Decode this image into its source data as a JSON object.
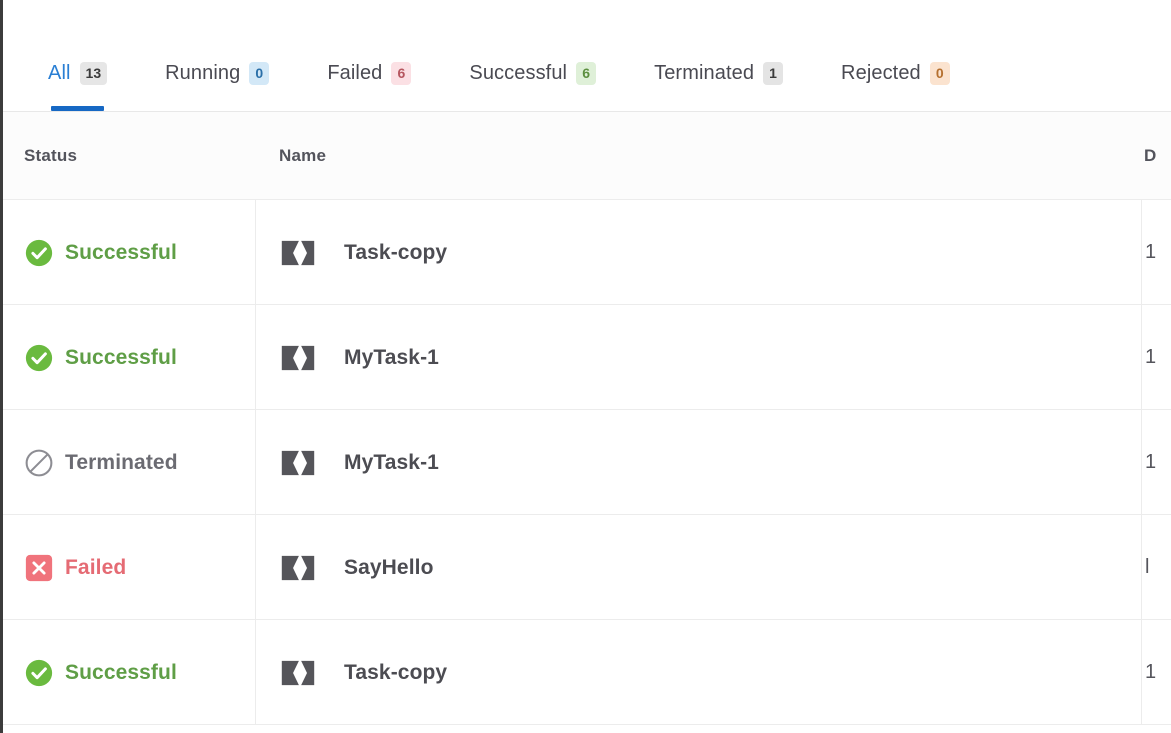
{
  "tabs": [
    {
      "label": "All",
      "count": "13",
      "active": true,
      "badge_bg": "#e6e6e6",
      "badge_fg": "#3a3a3a",
      "icon": "tab-all"
    },
    {
      "label": "Running",
      "count": "0",
      "active": false,
      "badge_bg": "#d3e8f7",
      "badge_fg": "#2a6fa8",
      "icon": "tab-running"
    },
    {
      "label": "Failed",
      "count": "6",
      "active": false,
      "badge_bg": "#fbe0e4",
      "badge_fg": "#b5565f",
      "icon": "tab-failed"
    },
    {
      "label": "Successful",
      "count": "6",
      "active": false,
      "badge_bg": "#dff0d8",
      "badge_fg": "#5c8f3f",
      "icon": "tab-successful"
    },
    {
      "label": "Terminated",
      "count": "1",
      "active": false,
      "badge_bg": "#e4e4e4",
      "badge_fg": "#3a3a3a",
      "icon": "tab-terminated"
    },
    {
      "label": "Rejected",
      "count": "0",
      "active": false,
      "badge_bg": "#fbe3cf",
      "badge_fg": "#b5702f",
      "icon": "tab-rejected"
    }
  ],
  "table": {
    "columns": {
      "status": "Status",
      "name": "Name",
      "extra": "D"
    },
    "rows": [
      {
        "status": "Successful",
        "status_kind": "successful",
        "status_icon": "check-circle-icon",
        "name": "Task-copy",
        "name_icon": "task-icon",
        "extra": "1"
      },
      {
        "status": "Successful",
        "status_kind": "successful",
        "status_icon": "check-circle-icon",
        "name": "MyTask-1",
        "name_icon": "task-icon",
        "extra": "1"
      },
      {
        "status": "Terminated",
        "status_kind": "terminated",
        "status_icon": "ban-circle-icon",
        "name": "MyTask-1",
        "name_icon": "task-icon",
        "extra": "1"
      },
      {
        "status": "Failed",
        "status_kind": "failed",
        "status_icon": "x-square-icon",
        "name": "SayHello",
        "name_icon": "task-icon",
        "extra": "l"
      },
      {
        "status": "Successful",
        "status_kind": "successful",
        "status_icon": "check-circle-icon",
        "name": "Task-copy",
        "name_icon": "task-icon",
        "extra": "1"
      }
    ]
  },
  "colors": {
    "accent": "#1668c4",
    "active_tab_text": "#2a7fd4",
    "success": "#5f9e46",
    "success_icon": "#6aba3f",
    "failed": "#e56b74",
    "failed_icon": "#f0737c",
    "terminated": "#6b6b72",
    "terminated_icon": "#8d8d93",
    "task_icon": "#55555a",
    "row_border": "#ececec",
    "left_rail": "#3c3c3c"
  }
}
